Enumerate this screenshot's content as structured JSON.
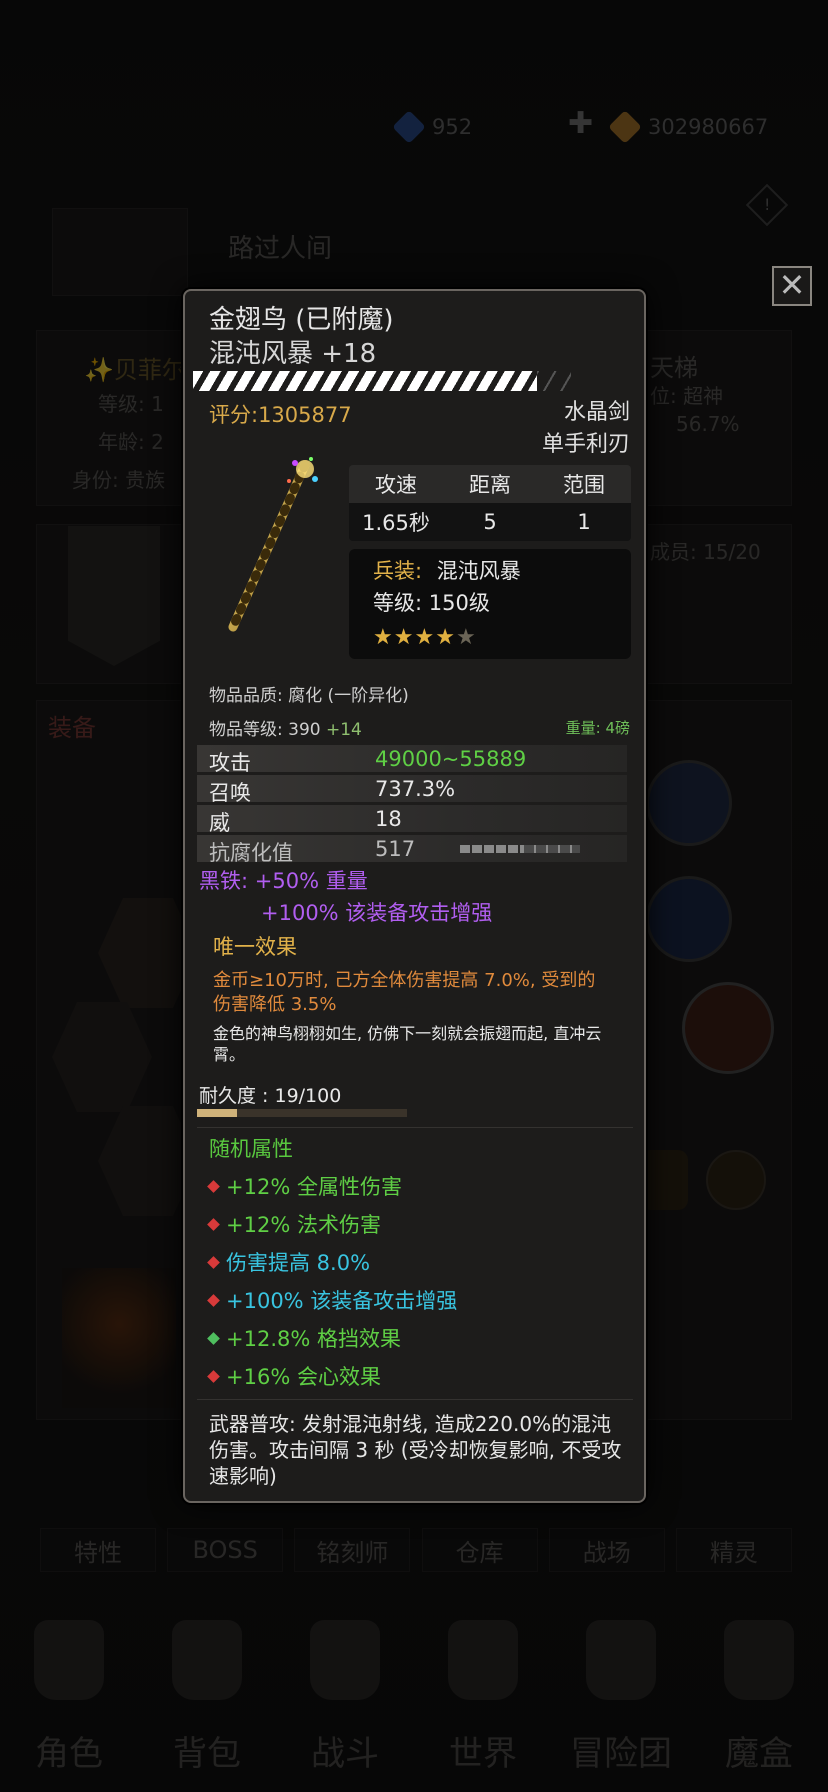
{
  "currency": {
    "crystal": "952",
    "gold": "302980667"
  },
  "profile": {
    "name_header": "路过人间",
    "char_name": "✨贝菲尔",
    "level_label": "等级: 1",
    "age_label": "年龄: 2",
    "identity_label": "身份: 贵族",
    "ladder_label": "天梯",
    "rank_label": "位: 超神",
    "rate_label": "56.7%",
    "members_label": "成员: 15/20",
    "equip_label": "装备"
  },
  "tabs": [
    "特性",
    "BOSS",
    "铭刻师",
    "仓库",
    "战场",
    "精灵"
  ],
  "nav": [
    "角色",
    "背包",
    "战斗",
    "世界",
    "冒险团",
    "魔盒"
  ],
  "item": {
    "name": "金翅鸟 (已附魔)",
    "subtitle": "混沌风暴 +18",
    "score": "评分:1305877",
    "type_line1": "水晶剑",
    "type_line2": "单手利刃",
    "stat_headers": [
      "攻速",
      "距离",
      "范围"
    ],
    "stat_values": [
      "1.65秒",
      "5",
      "1"
    ],
    "armament_label": "兵装:",
    "armament_value": "混沌风暴",
    "armament_level": "等级:  150级",
    "stars_filled": 4,
    "stars_total": 5,
    "quality": "物品品质: 腐化 (一阶异化)",
    "item_level": "物品等级: 390",
    "item_level_bonus": "+14",
    "weight": "重量: 4磅",
    "attributes": [
      {
        "name": "攻击",
        "value": "49000~55889",
        "color": "#5fcf45"
      },
      {
        "name": "召唤",
        "value": "737.3%",
        "color": "#e8e8e8"
      },
      {
        "name": "威",
        "value": "18",
        "color": "#e8e8e8"
      },
      {
        "name": "抗腐化值",
        "value": "517",
        "color": "#e8e8e8"
      }
    ],
    "corrosion_fraction": 0.47,
    "enchant_line1": "黑铁: +50% 重量",
    "enchant_line2": "+100% 该装备攻击增强",
    "unique_title": "唯一效果",
    "unique_text": "金币≥10万时, 己方全体伤害提高 7.0%, 受到的伤害降低 3.5%",
    "flavor_text": "金色的神鸟栩栩如生, 仿佛下一刻就会振翅而起, 直冲云霄。",
    "durability_label": "耐久度 : 19/100",
    "durability_fraction": 0.19,
    "random_title": "随机属性",
    "random_attrs": [
      {
        "text": "+12% 全属性伤害",
        "color": "#5fcf45",
        "dot": "#d83a3a"
      },
      {
        "text": "+12% 法术伤害",
        "color": "#5fcf45",
        "dot": "#d83a3a"
      },
      {
        "text": "伤害提高 8.0%",
        "color": "#39c4e0",
        "dot": "#d83a3a"
      },
      {
        "text": "+100% 该装备攻击增强",
        "color": "#39c4e0",
        "dot": "#d83a3a"
      },
      {
        "text": "+12.8% 格挡效果",
        "color": "#5fcf45",
        "dot": "#4fbf5f"
      },
      {
        "text": "+16% 会心效果",
        "color": "#5fcf45",
        "dot": "#d83a3a"
      }
    ],
    "description": "武器普攻: 发射混沌射线, 造成220.0%的混沌伤害。攻击间隔 3 秒 (受冷却恢复影响, 不受攻速影响)"
  },
  "colors": {
    "score": "#d8a94a",
    "purple": "#b15ef0",
    "gold_star": "#e0b040",
    "empty_star": "#6a6456"
  }
}
